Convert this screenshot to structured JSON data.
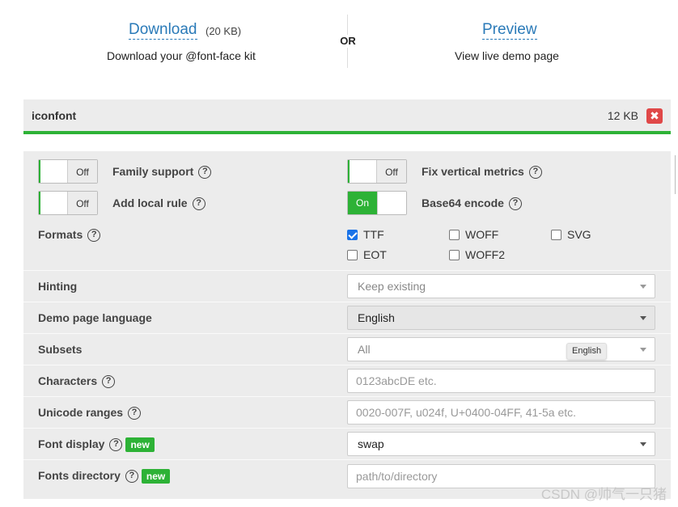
{
  "top": {
    "download_label": "Download",
    "download_size": "(20 KB)",
    "download_desc": "Download your @font-face kit",
    "or_label": "OR",
    "preview_label": "Preview",
    "preview_desc": "View live demo page"
  },
  "font": {
    "name": "iconfont",
    "size": "12 KB",
    "remove_icon": "✖"
  },
  "options": {
    "family_support": {
      "label": "Family support",
      "state": "Off"
    },
    "fix_vertical": {
      "label": "Fix vertical metrics",
      "state": "Off"
    },
    "add_local": {
      "label": "Add local rule",
      "state": "Off"
    },
    "base64": {
      "label": "Base64 encode",
      "state": "On"
    },
    "formats": {
      "label": "Formats",
      "items": [
        {
          "name": "TTF",
          "checked": true
        },
        {
          "name": "WOFF",
          "checked": false
        },
        {
          "name": "SVG",
          "checked": false
        },
        {
          "name": "EOT",
          "checked": false
        },
        {
          "name": "WOFF2",
          "checked": false
        }
      ]
    },
    "hinting": {
      "label": "Hinting",
      "value": "Keep existing"
    },
    "demo_lang": {
      "label": "Demo page language",
      "value": "English"
    },
    "subsets": {
      "label": "Subsets",
      "value": "All",
      "tooltip": "English"
    },
    "characters": {
      "label": "Characters",
      "placeholder": "0123abcDE etc."
    },
    "unicode_ranges": {
      "label": "Unicode ranges",
      "placeholder": "0020-007F, u024f, U+0400-04FF, 41-5a etc."
    },
    "font_display": {
      "label": "Font display",
      "badge": "new",
      "value": "swap"
    },
    "fonts_directory": {
      "label": "Fonts directory",
      "badge": "new",
      "placeholder": "path/to/directory"
    }
  },
  "help_glyph": "?",
  "watermark": "CSDN @帅气一只猪",
  "colors": {
    "accent_green": "#2db236",
    "link_blue": "#2a7ab8",
    "danger_red": "#e04848",
    "check_blue": "#1a73e8"
  }
}
